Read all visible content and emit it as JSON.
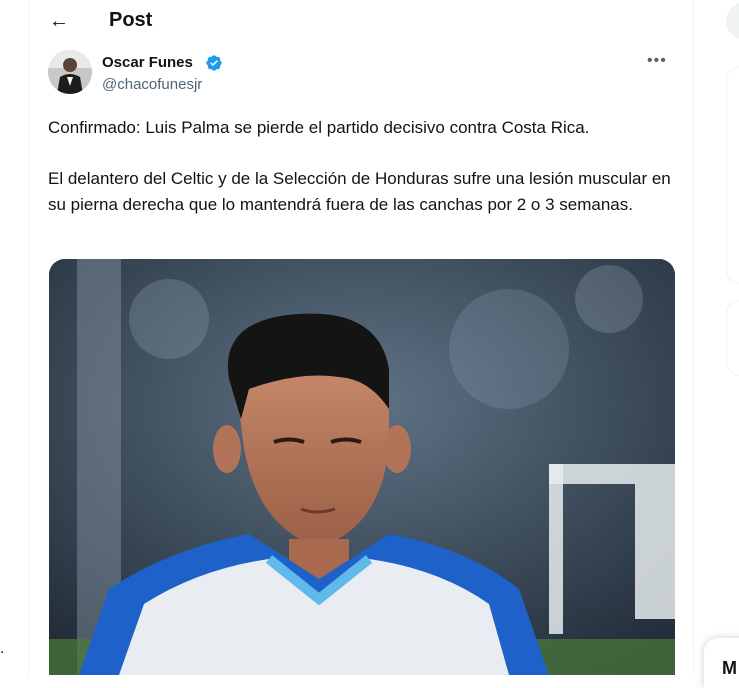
{
  "header": {
    "back_icon": "←",
    "title": "Post"
  },
  "author": {
    "name": "Oscar Funes",
    "handle": "@chacofunesjr",
    "verified": true
  },
  "more_icon": "•••",
  "tweet": {
    "paragraphs": [
      "Confirmado: Luis Palma se pierde el partido decisivo contra Costa Rica.",
      "El delantero del Celtic y de la Selección de Honduras sufre una lesión muscular en su pierna derecha que lo mantendrá fuera de las canchas por 2 o 3 semanas."
    ]
  },
  "sidebar_partial": {
    "messages_label": "M"
  },
  "stray_mark": ".",
  "colors": {
    "accent": "#1d9bf0",
    "text": "#0f1419",
    "secondary": "#536471",
    "border": "#eff3f4"
  },
  "icons": {
    "back": "arrow-left-icon",
    "verified": "verified-badge-icon",
    "more": "more-horizontal-icon"
  }
}
